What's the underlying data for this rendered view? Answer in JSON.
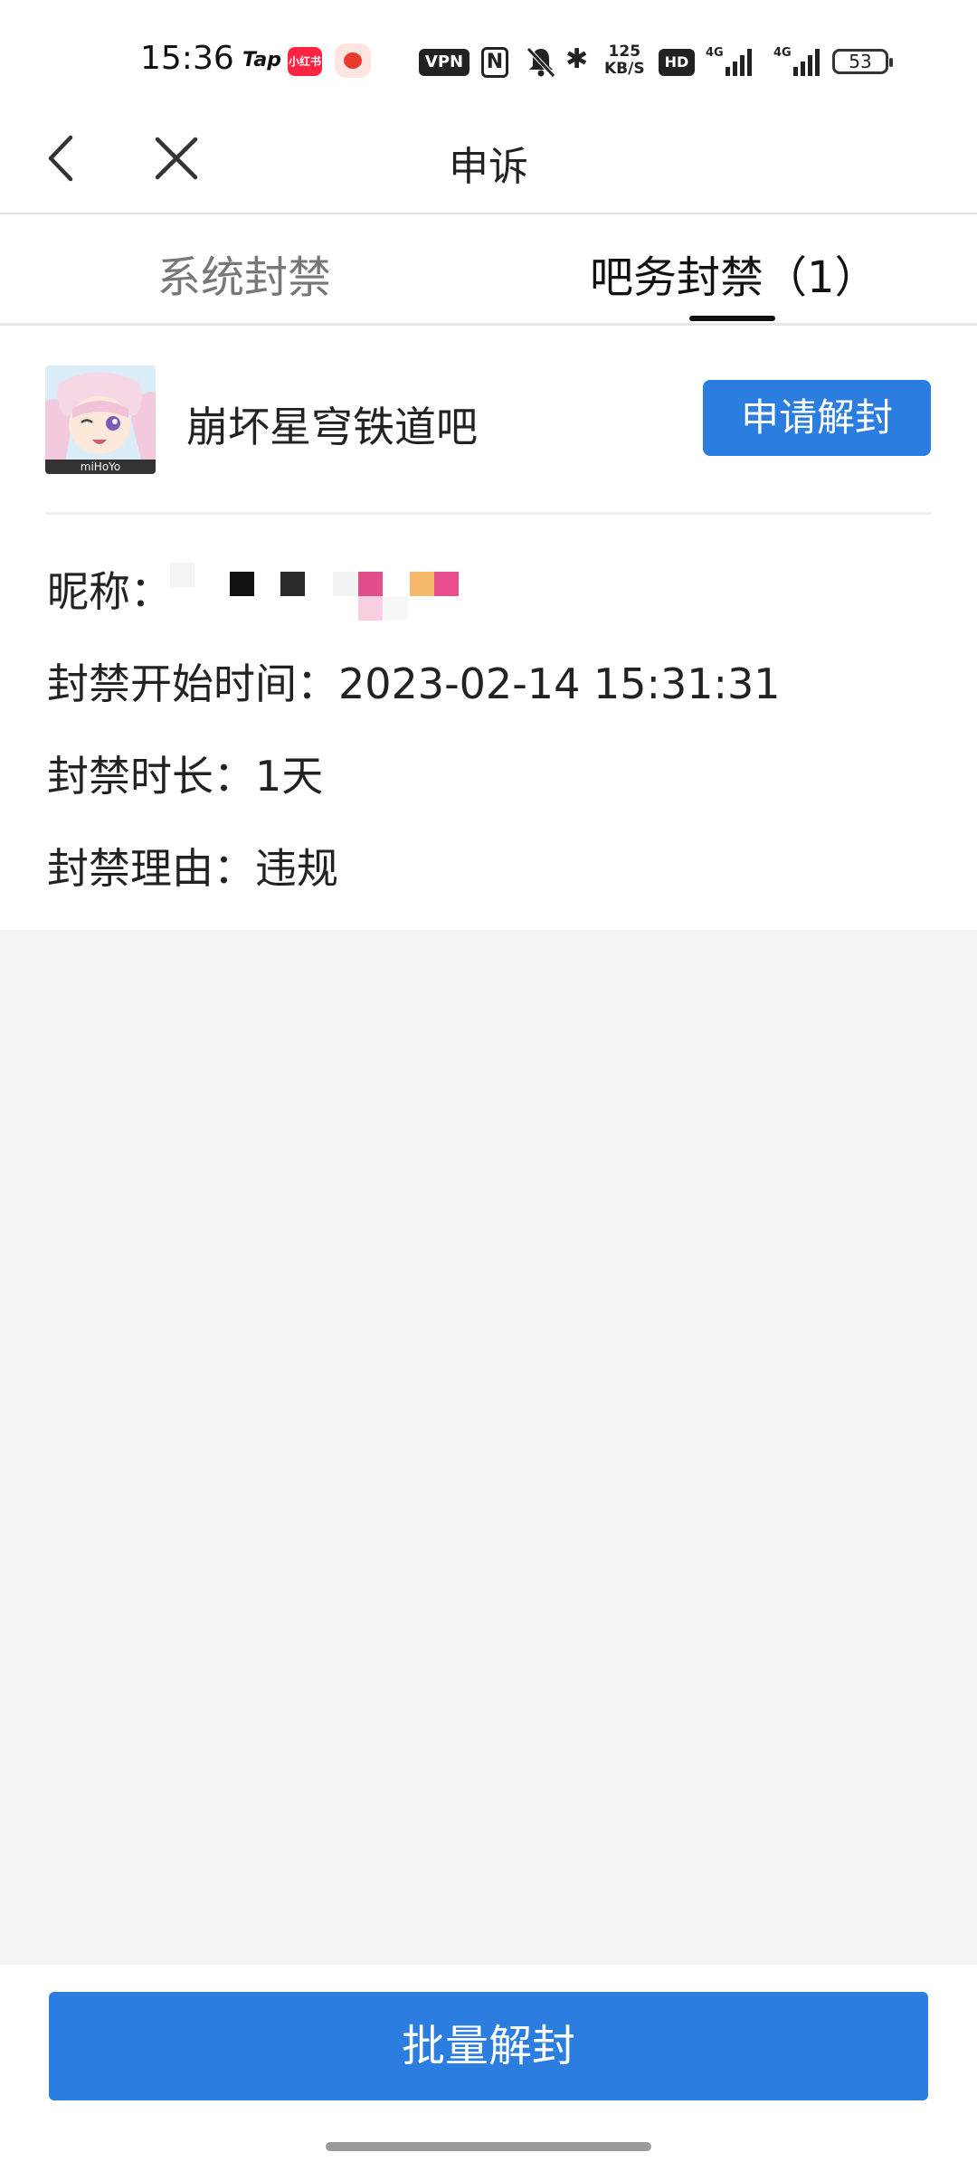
{
  "status_bar": {
    "time": "15:36",
    "tap_label": "Tap",
    "redbook_label": "小红书",
    "vpn_label": "VPN",
    "nfc_label": "N",
    "speed_value": "125",
    "speed_unit": "KB/S",
    "hd_label": "HD",
    "network_label": "4G",
    "battery": "53"
  },
  "nav": {
    "title": "申诉"
  },
  "tabs": [
    {
      "label": "系统封禁",
      "active": false
    },
    {
      "label": "吧务封禁（1）",
      "active": true
    }
  ],
  "ban_record": {
    "forum_name": "崩坏星穹铁道吧",
    "avatar_caption": "miHoYo",
    "apply_button": "申请解封",
    "nickname_label": "昵称：",
    "start_time": "封禁开始时间：2023-02-14 15:31:31",
    "duration": "封禁时长：1天",
    "reason": "封禁理由：违规"
  },
  "footer": {
    "batch_button": "批量解封"
  },
  "colors": {
    "accent": "#2b7de0",
    "page_bg": "#f4f4f4"
  }
}
